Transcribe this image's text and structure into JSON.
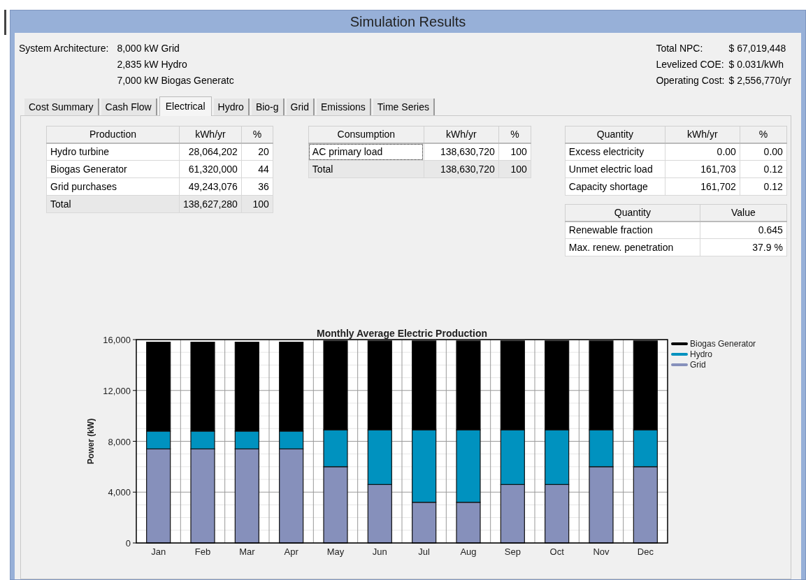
{
  "window": {
    "title": "Simulation Results"
  },
  "architecture": {
    "label": "System Architecture:",
    "items": [
      "8,000 kW Grid",
      "2,835 kW Hydro",
      "7,000 kW Biogas Generatc"
    ]
  },
  "costs": [
    {
      "label": "Total NPC:",
      "value": "$ 67,019,448"
    },
    {
      "label": "Levelized COE:",
      "value": "$ 0.031/kWh"
    },
    {
      "label": "Operating Cost:",
      "value": "$ 2,556,770/yr"
    }
  ],
  "tabs": [
    {
      "label": "Cost Summary",
      "selected": false
    },
    {
      "label": "Cash Flow",
      "selected": false
    },
    {
      "label": "Electrical",
      "selected": true
    },
    {
      "label": "Hydro",
      "selected": false
    },
    {
      "label": "Bio-g",
      "selected": false
    },
    {
      "label": "Grid",
      "selected": false
    },
    {
      "label": "Emissions",
      "selected": false
    },
    {
      "label": "Time Series",
      "selected": false
    }
  ],
  "tables": [
    {
      "columns": [
        "Production",
        "kWh/yr",
        "%"
      ],
      "rows": [
        {
          "cells": [
            "Hydro turbine",
            "28,064,202",
            "20"
          ],
          "total": false,
          "focused": false
        },
        {
          "cells": [
            "Biogas Generator",
            "61,320,000",
            "44"
          ],
          "total": false,
          "focused": false
        },
        {
          "cells": [
            "Grid purchases",
            "49,243,076",
            "36"
          ],
          "total": false,
          "focused": false
        },
        {
          "cells": [
            "Total",
            "138,627,280",
            "100"
          ],
          "total": true,
          "focused": false
        }
      ]
    },
    {
      "columns": [
        "Consumption",
        "kWh/yr",
        "%"
      ],
      "rows": [
        {
          "cells": [
            "AC primary load",
            "138,630,720",
            "100"
          ],
          "total": false,
          "focused": true
        },
        {
          "cells": [
            "Total",
            "138,630,720",
            "100"
          ],
          "total": true,
          "focused": false
        }
      ]
    },
    {
      "columns": [
        "Quantity",
        "kWh/yr",
        "%"
      ],
      "rows": [
        {
          "cells": [
            "Excess electricity",
            "0.00",
            "0.00"
          ],
          "total": false,
          "focused": false
        },
        {
          "cells": [
            "Unmet electric load",
            "161,703",
            "0.12"
          ],
          "total": false,
          "focused": false
        },
        {
          "cells": [
            "Capacity shortage",
            "161,702",
            "0.12"
          ],
          "total": false,
          "focused": false
        }
      ]
    },
    {
      "columns": [
        "Quantity",
        "Value"
      ],
      "rows": [
        {
          "cells": [
            "Renewable fraction",
            "0.645"
          ],
          "total": false,
          "focused": false
        },
        {
          "cells": [
            "Max. renew. penetration",
            "37.9 %"
          ],
          "total": false,
          "focused": false
        }
      ]
    }
  ],
  "chart_data": {
    "type": "bar",
    "title": "Monthly Average Electric Production",
    "ylabel": "Power (kW)",
    "stacked": true,
    "categories": [
      "Jan",
      "Feb",
      "Mar",
      "Apr",
      "May",
      "Jun",
      "Jul",
      "Aug",
      "Sep",
      "Oct",
      "Nov",
      "Dec"
    ],
    "series": [
      {
        "name": "Grid",
        "color": "#8690bb",
        "values": [
          7400,
          7400,
          7400,
          7400,
          6000,
          4600,
          3200,
          3200,
          4600,
          4600,
          6000,
          6000
        ]
      },
      {
        "name": "Hydro",
        "color": "#0092bf",
        "values": [
          1400,
          1400,
          1400,
          1400,
          2900,
          4300,
          5700,
          5700,
          4300,
          4300,
          2900,
          2900
        ]
      },
      {
        "name": "Biogas Generator",
        "color": "#000000",
        "values": [
          7000,
          7000,
          7000,
          7000,
          7000,
          7000,
          7000,
          7000,
          7000,
          7000,
          7000,
          7000
        ]
      }
    ],
    "grid": true,
    "legend": true,
    "ylim": [
      0,
      16000
    ],
    "yticks": [
      {
        "value": 0,
        "label": "0"
      },
      {
        "value": 4000,
        "label": "4,000"
      },
      {
        "value": 8000,
        "label": "8,000"
      },
      {
        "value": 12000,
        "label": "12,000"
      },
      {
        "value": 16000,
        "label": "16,000"
      }
    ]
  }
}
